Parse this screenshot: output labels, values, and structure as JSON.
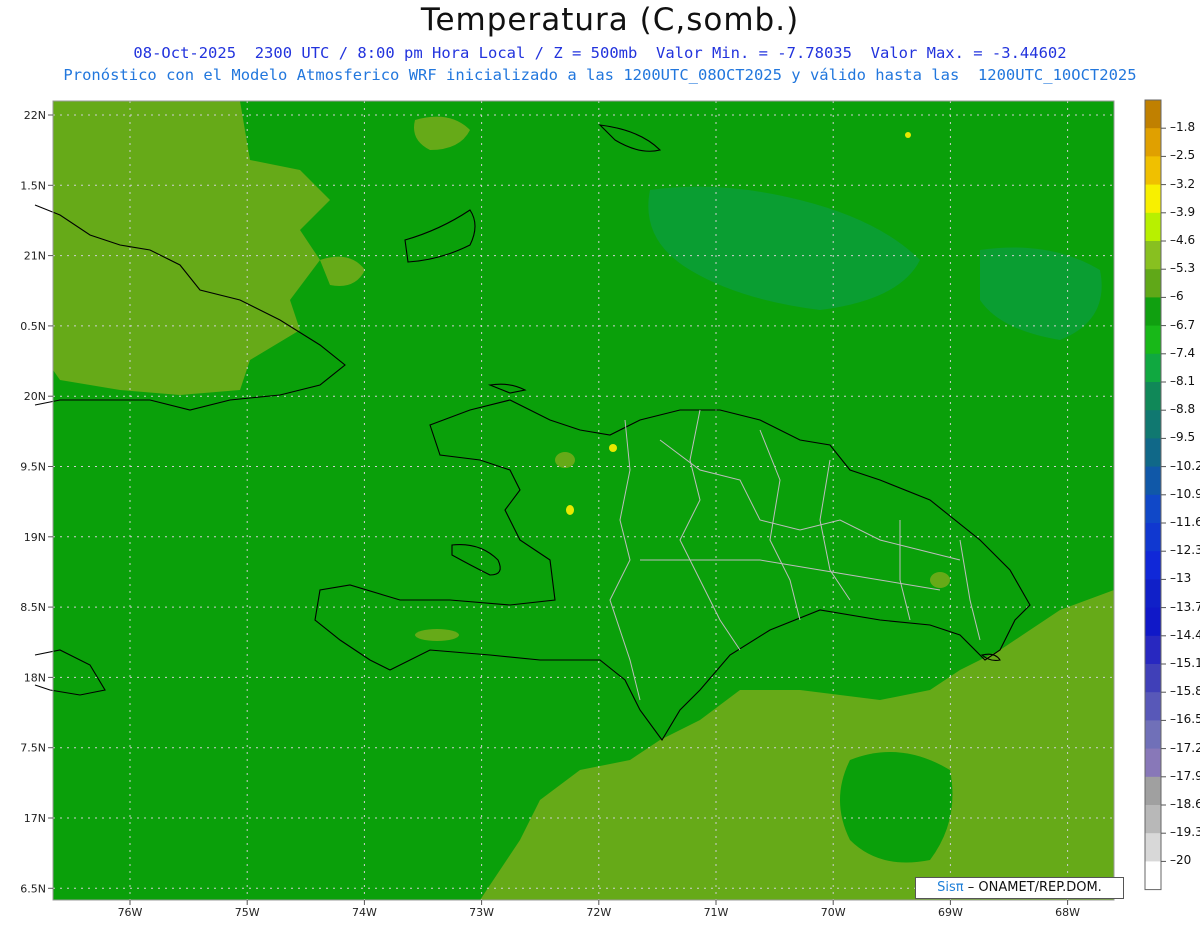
{
  "title": "Temperatura (C,somb.)",
  "subtitle_line1": "08-Oct-2025  2300 UTC / 8:00 pm Hora Local / Z = 500mb  Valor Min. = -7.78035  Valor Max. = -3.44602",
  "subtitle_line2": "Pronóstico con el Modelo Atmosferico WRF inicializado a las 1200UTC_08OCT2025 y válido hasta las  1200UTC_10OCT2025",
  "map": {
    "lat_labels": [
      "22N",
      "1.5N",
      "21N",
      "0.5N",
      "20N",
      "9.5N",
      "19N",
      "8.5N",
      "18N",
      "7.5N",
      "17N",
      "6.5N"
    ],
    "lon_labels": [
      "76W",
      "75W",
      "74W",
      "73W",
      "72W",
      "71W",
      "70W",
      "69W",
      "68W"
    ],
    "field": {
      "variable": "Temperatura",
      "units": "C",
      "level": "500mb",
      "min": -7.78035,
      "max": -3.44602
    },
    "colors": {
      "background_dominant": "#0aa00a",
      "warmer_zone": "#66aa18",
      "cooler_zone": "#0a9e3c",
      "warm_spot": "#e8e800",
      "coastline": "#000000",
      "province_borders": "#bbbbbb",
      "grid": "#cccccc"
    }
  },
  "colorbar": {
    "labels": [
      "-1.8",
      "-2.5",
      "-3.2",
      "-3.9",
      "-4.6",
      "-5.3",
      "-6",
      "-6.7",
      "-7.4",
      "-8.1",
      "-8.8",
      "-9.5",
      "-10.2",
      "-10.9",
      "-11.6",
      "-12.3",
      "-13",
      "-13.7",
      "-14.4",
      "-15.1",
      "-15.8",
      "-16.5",
      "-17.2",
      "-17.9",
      "-18.6",
      "-19.3",
      "-20"
    ],
    "colors": [
      "#c08000",
      "#e0a000",
      "#f0c000",
      "#f8f000",
      "#b8f000",
      "#88c020",
      "#60a818",
      "#10a010",
      "#18b818",
      "#10a840",
      "#108858",
      "#107870",
      "#106888",
      "#1058a8",
      "#1048c8",
      "#1038d0",
      "#1028d8",
      "#1020c8",
      "#1018c8",
      "#2828c0",
      "#4040b8",
      "#5858b8",
      "#7070b8",
      "#8878b8",
      "#a0a0a0",
      "#b8b8b8",
      "#d8d8d8",
      "#ffffff"
    ]
  },
  "credit": {
    "brand": "Sisπ",
    "text": "– ONAMET/REP.DOM."
  }
}
